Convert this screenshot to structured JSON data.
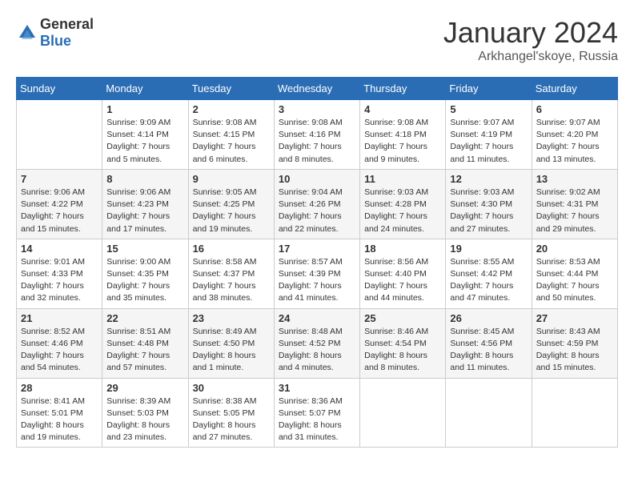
{
  "header": {
    "logo": {
      "general": "General",
      "blue": "Blue"
    },
    "month": "January 2024",
    "location": "Arkhangel'skoye, Russia"
  },
  "weekdays": [
    "Sunday",
    "Monday",
    "Tuesday",
    "Wednesday",
    "Thursday",
    "Friday",
    "Saturday"
  ],
  "weeks": [
    [
      {
        "day": "",
        "info": ""
      },
      {
        "day": "1",
        "info": "Sunrise: 9:09 AM\nSunset: 4:14 PM\nDaylight: 7 hours\nand 5 minutes."
      },
      {
        "day": "2",
        "info": "Sunrise: 9:08 AM\nSunset: 4:15 PM\nDaylight: 7 hours\nand 6 minutes."
      },
      {
        "day": "3",
        "info": "Sunrise: 9:08 AM\nSunset: 4:16 PM\nDaylight: 7 hours\nand 8 minutes."
      },
      {
        "day": "4",
        "info": "Sunrise: 9:08 AM\nSunset: 4:18 PM\nDaylight: 7 hours\nand 9 minutes."
      },
      {
        "day": "5",
        "info": "Sunrise: 9:07 AM\nSunset: 4:19 PM\nDaylight: 7 hours\nand 11 minutes."
      },
      {
        "day": "6",
        "info": "Sunrise: 9:07 AM\nSunset: 4:20 PM\nDaylight: 7 hours\nand 13 minutes."
      }
    ],
    [
      {
        "day": "7",
        "info": "Sunrise: 9:06 AM\nSunset: 4:22 PM\nDaylight: 7 hours\nand 15 minutes."
      },
      {
        "day": "8",
        "info": "Sunrise: 9:06 AM\nSunset: 4:23 PM\nDaylight: 7 hours\nand 17 minutes."
      },
      {
        "day": "9",
        "info": "Sunrise: 9:05 AM\nSunset: 4:25 PM\nDaylight: 7 hours\nand 19 minutes."
      },
      {
        "day": "10",
        "info": "Sunrise: 9:04 AM\nSunset: 4:26 PM\nDaylight: 7 hours\nand 22 minutes."
      },
      {
        "day": "11",
        "info": "Sunrise: 9:03 AM\nSunset: 4:28 PM\nDaylight: 7 hours\nand 24 minutes."
      },
      {
        "day": "12",
        "info": "Sunrise: 9:03 AM\nSunset: 4:30 PM\nDaylight: 7 hours\nand 27 minutes."
      },
      {
        "day": "13",
        "info": "Sunrise: 9:02 AM\nSunset: 4:31 PM\nDaylight: 7 hours\nand 29 minutes."
      }
    ],
    [
      {
        "day": "14",
        "info": "Sunrise: 9:01 AM\nSunset: 4:33 PM\nDaylight: 7 hours\nand 32 minutes."
      },
      {
        "day": "15",
        "info": "Sunrise: 9:00 AM\nSunset: 4:35 PM\nDaylight: 7 hours\nand 35 minutes."
      },
      {
        "day": "16",
        "info": "Sunrise: 8:58 AM\nSunset: 4:37 PM\nDaylight: 7 hours\nand 38 minutes."
      },
      {
        "day": "17",
        "info": "Sunrise: 8:57 AM\nSunset: 4:39 PM\nDaylight: 7 hours\nand 41 minutes."
      },
      {
        "day": "18",
        "info": "Sunrise: 8:56 AM\nSunset: 4:40 PM\nDaylight: 7 hours\nand 44 minutes."
      },
      {
        "day": "19",
        "info": "Sunrise: 8:55 AM\nSunset: 4:42 PM\nDaylight: 7 hours\nand 47 minutes."
      },
      {
        "day": "20",
        "info": "Sunrise: 8:53 AM\nSunset: 4:44 PM\nDaylight: 7 hours\nand 50 minutes."
      }
    ],
    [
      {
        "day": "21",
        "info": "Sunrise: 8:52 AM\nSunset: 4:46 PM\nDaylight: 7 hours\nand 54 minutes."
      },
      {
        "day": "22",
        "info": "Sunrise: 8:51 AM\nSunset: 4:48 PM\nDaylight: 7 hours\nand 57 minutes."
      },
      {
        "day": "23",
        "info": "Sunrise: 8:49 AM\nSunset: 4:50 PM\nDaylight: 8 hours\nand 1 minute."
      },
      {
        "day": "24",
        "info": "Sunrise: 8:48 AM\nSunset: 4:52 PM\nDaylight: 8 hours\nand 4 minutes."
      },
      {
        "day": "25",
        "info": "Sunrise: 8:46 AM\nSunset: 4:54 PM\nDaylight: 8 hours\nand 8 minutes."
      },
      {
        "day": "26",
        "info": "Sunrise: 8:45 AM\nSunset: 4:56 PM\nDaylight: 8 hours\nand 11 minutes."
      },
      {
        "day": "27",
        "info": "Sunrise: 8:43 AM\nSunset: 4:59 PM\nDaylight: 8 hours\nand 15 minutes."
      }
    ],
    [
      {
        "day": "28",
        "info": "Sunrise: 8:41 AM\nSunset: 5:01 PM\nDaylight: 8 hours\nand 19 minutes."
      },
      {
        "day": "29",
        "info": "Sunrise: 8:39 AM\nSunset: 5:03 PM\nDaylight: 8 hours\nand 23 minutes."
      },
      {
        "day": "30",
        "info": "Sunrise: 8:38 AM\nSunset: 5:05 PM\nDaylight: 8 hours\nand 27 minutes."
      },
      {
        "day": "31",
        "info": "Sunrise: 8:36 AM\nSunset: 5:07 PM\nDaylight: 8 hours\nand 31 minutes."
      },
      {
        "day": "",
        "info": ""
      },
      {
        "day": "",
        "info": ""
      },
      {
        "day": "",
        "info": ""
      }
    ]
  ]
}
